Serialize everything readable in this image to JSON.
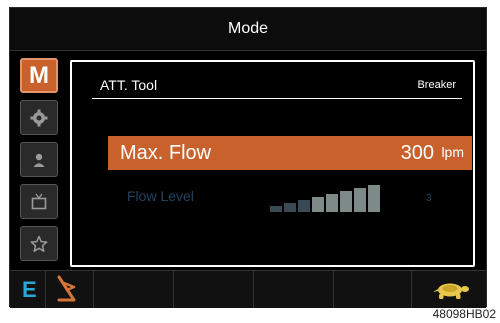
{
  "title": "Mode",
  "sidebar": {
    "items": [
      {
        "label": "M",
        "icon": "mode-icon",
        "active": true
      },
      {
        "icon": "gear-icon"
      },
      {
        "icon": "user-icon"
      },
      {
        "icon": "tv-icon"
      },
      {
        "icon": "star-icon"
      }
    ]
  },
  "attachment": {
    "label": "ATT. Tool",
    "value": "Breaker"
  },
  "max_flow": {
    "label": "Max. Flow",
    "value": "300",
    "unit": "lpm"
  },
  "flow_level": {
    "label": "Flow Level",
    "value": "3",
    "bars_total": 8,
    "bars_highlighted": 5
  },
  "bottom_bar": {
    "mode_indicator": "E",
    "icons": [
      "attachment-arm-icon",
      "turtle-icon"
    ]
  },
  "caption": "48098HB02",
  "colors": {
    "accent": "#c8612c",
    "indicator_blue": "#28a8d6",
    "dim_text": "#23435f",
    "turtle": "#e8c84a"
  }
}
